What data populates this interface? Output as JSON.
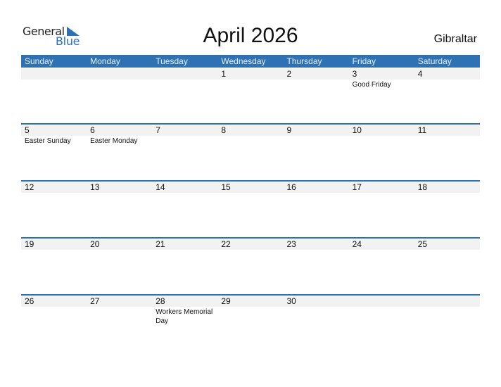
{
  "logo": {
    "part1": "General",
    "part2": "Blue"
  },
  "title": "April 2026",
  "country": "Gibraltar",
  "colors": {
    "header_bg": "#2f72b3",
    "day_band": "#f2f2f2",
    "brand_blue": "#2a71b8"
  },
  "weekdays": [
    "Sunday",
    "Monday",
    "Tuesday",
    "Wednesday",
    "Thursday",
    "Friday",
    "Saturday"
  ],
  "weeks": [
    [
      {
        "day": "",
        "holiday": ""
      },
      {
        "day": "",
        "holiday": ""
      },
      {
        "day": "",
        "holiday": ""
      },
      {
        "day": "1",
        "holiday": ""
      },
      {
        "day": "2",
        "holiday": ""
      },
      {
        "day": "3",
        "holiday": "Good Friday"
      },
      {
        "day": "4",
        "holiday": ""
      }
    ],
    [
      {
        "day": "5",
        "holiday": "Easter Sunday"
      },
      {
        "day": "6",
        "holiday": "Easter Monday"
      },
      {
        "day": "7",
        "holiday": ""
      },
      {
        "day": "8",
        "holiday": ""
      },
      {
        "day": "9",
        "holiday": ""
      },
      {
        "day": "10",
        "holiday": ""
      },
      {
        "day": "11",
        "holiday": ""
      }
    ],
    [
      {
        "day": "12",
        "holiday": ""
      },
      {
        "day": "13",
        "holiday": ""
      },
      {
        "day": "14",
        "holiday": ""
      },
      {
        "day": "15",
        "holiday": ""
      },
      {
        "day": "16",
        "holiday": ""
      },
      {
        "day": "17",
        "holiday": ""
      },
      {
        "day": "18",
        "holiday": ""
      }
    ],
    [
      {
        "day": "19",
        "holiday": ""
      },
      {
        "day": "20",
        "holiday": ""
      },
      {
        "day": "21",
        "holiday": ""
      },
      {
        "day": "22",
        "holiday": ""
      },
      {
        "day": "23",
        "holiday": ""
      },
      {
        "day": "24",
        "holiday": ""
      },
      {
        "day": "25",
        "holiday": ""
      }
    ],
    [
      {
        "day": "26",
        "holiday": ""
      },
      {
        "day": "27",
        "holiday": ""
      },
      {
        "day": "28",
        "holiday": "Workers Memorial Day"
      },
      {
        "day": "29",
        "holiday": ""
      },
      {
        "day": "30",
        "holiday": ""
      },
      {
        "day": "",
        "holiday": ""
      },
      {
        "day": "",
        "holiday": ""
      }
    ]
  ]
}
